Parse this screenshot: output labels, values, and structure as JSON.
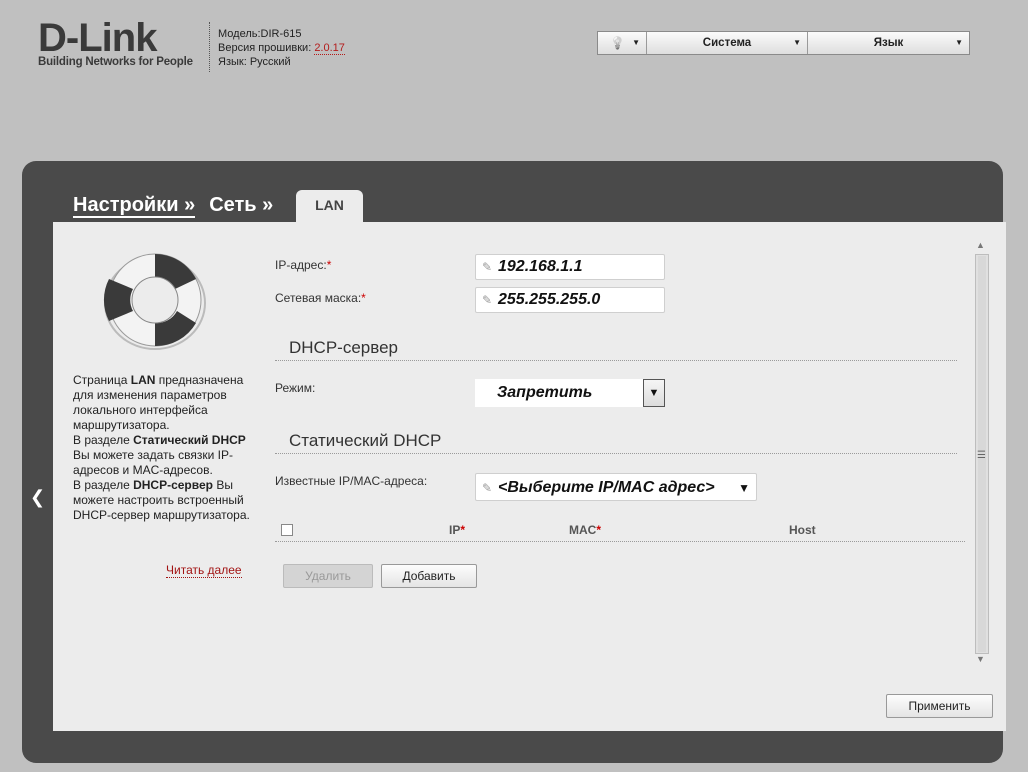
{
  "header": {
    "logo_main": "D-Link",
    "logo_sub": "Building Networks for People",
    "model_label": "Модель:",
    "model": "DIR-615",
    "fw_label": "Версия прошивки:",
    "fw": "2.0.17",
    "lang_label": "Язык:",
    "lang": "Русский"
  },
  "topmenu": {
    "bulb": "💡",
    "system": "Система",
    "language": "Язык"
  },
  "breadcrumb": {
    "item1": "Настройки »",
    "item2": "Сеть »",
    "tab": "LAN"
  },
  "help": {
    "p1_a": "Страница ",
    "p1_b": "LAN",
    "p1_c": " предназначена для изменения параметров локального интерфейса маршрутизатора.",
    "p2_a": "В разделе ",
    "p2_b": "Статический DHCP",
    "p2_c": " Вы можете задать связки IP-адресов и MAC-адресов.",
    "p3_a": "В разделе ",
    "p3_b": "DHCP-сервер",
    "p3_c": " Вы можете настроить встроенный DHCP-сервер маршрутизатора.",
    "readmore": "Читать далее"
  },
  "form": {
    "ip_label": "IP-адрес:",
    "ip_value": "192.168.1.1",
    "mask_label": "Сетевая маска:",
    "mask_value": "255.255.255.0",
    "dhcp_section": "DHCP-сервер",
    "mode_label": "Режим:",
    "mode_value": "Запретить",
    "static_section": "Статический DHCP",
    "known_label": "Известные IP/MAC-адреса:",
    "known_value": "<Выберите IP/MAC адрес>",
    "req": "*"
  },
  "table": {
    "headers": [
      "IP",
      "MAC",
      "Host"
    ]
  },
  "buttons": {
    "delete": "Удалить",
    "add": "Добавить",
    "apply": "Применить"
  }
}
